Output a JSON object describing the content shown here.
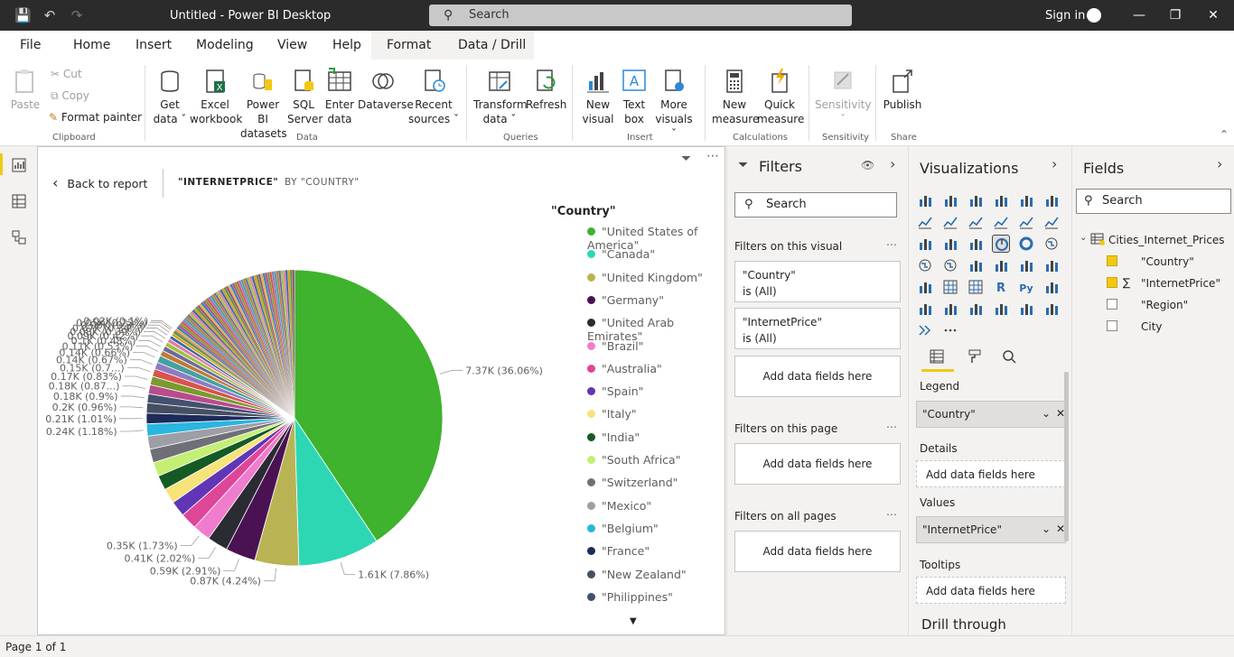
{
  "titlebar": {
    "title": "Untitled - Power BI Desktop",
    "search": "Search",
    "signin": "Sign in"
  },
  "menu": {
    "tabs": [
      "File",
      "Home",
      "Insert",
      "Modeling",
      "View",
      "Help",
      "Format",
      "Data / Drill"
    ]
  },
  "ribbon": {
    "clipboard": {
      "paste": "Paste",
      "cut": "Cut",
      "copy": "Copy",
      "format_painter": "Format painter",
      "group": "Clipboard"
    },
    "data": {
      "get1": "Get",
      "get2": "data",
      "excel1": "Excel",
      "excel2": "workbook",
      "pbi1": "Power BI",
      "pbi2": "datasets",
      "sql1": "SQL",
      "sql2": "Server",
      "enter1": "Enter",
      "enter2": "data",
      "dataverse": "Dataverse",
      "recent1": "Recent",
      "recent2": "sources",
      "group": "Data"
    },
    "queries": {
      "transform1": "Transform",
      "transform2": "data",
      "refresh": "Refresh",
      "group": "Queries"
    },
    "insert": {
      "newvis1": "New",
      "newvis2": "visual",
      "text1": "Text",
      "text2": "box",
      "more1": "More",
      "more2": "visuals",
      "group": "Insert"
    },
    "calc": {
      "newm1": "New",
      "newm2": "measure",
      "quick1": "Quick",
      "quick2": "measure",
      "group": "Calculations"
    },
    "sensitivity": {
      "label": "Sensitivity",
      "group": "Sensitivity"
    },
    "share": {
      "publish": "Publish",
      "group": "Share"
    }
  },
  "canvas": {
    "back": "Back to report",
    "crumb1": "\"INTERNETPRICE\"",
    "crumb2": "BY \"COUNTRY\"",
    "legend_title": "\"Country\""
  },
  "chart_data": {
    "type": "pie",
    "title": "",
    "legend_title": "\"Country\"",
    "legend": [
      "\"United States of America\"",
      "\"Canada\"",
      "\"United Kingdom\"",
      "\"Germany\"",
      "\"United Arab Emirates\"",
      "\"Brazil\"",
      "\"Australia\"",
      "\"Spain\"",
      "\"Italy\"",
      "\"India\"",
      "\"South Africa\"",
      "\"Switzerland\"",
      "\"Mexico\"",
      "\"Belgium\"",
      "\"France\"",
      "\"New Zealand\"",
      "\"Philippines\""
    ],
    "legend_colors": [
      "#3fb22e",
      "#2ed7b4",
      "#bab354",
      "#4a1153",
      "#2b2b33",
      "#f07ccd",
      "#de4697",
      "#6036b7",
      "#f6e37a",
      "#155a24",
      "#c4ef74",
      "#6f6f78",
      "#9e9ea6",
      "#29b6e0",
      "#1c2b5a",
      "#454f62",
      "#44516e"
    ],
    "slices": [
      {
        "label": "7.37K (36.06%)",
        "value": 7.37
      },
      {
        "label": "1.61K (7.86%)",
        "value": 1.61
      },
      {
        "label": "0.87K (4.24%)",
        "value": 0.87
      },
      {
        "label": "0.59K (2.91%)",
        "value": 0.59
      },
      {
        "label": "0.41K (2.02%)",
        "value": 0.41
      },
      {
        "label": "0.35K (1.73%)",
        "value": 0.35
      },
      {
        "label": "",
        "value": 0.33
      },
      {
        "label": "",
        "value": 0.31
      },
      {
        "label": "",
        "value": 0.3
      },
      {
        "label": "",
        "value": 0.29
      },
      {
        "label": "",
        "value": 0.28
      },
      {
        "label": "",
        "value": 0.27
      },
      {
        "label": "",
        "value": 0.26
      },
      {
        "label": "0.24K (1.18%)",
        "value": 0.24
      },
      {
        "label": "0.21K (1.01%)",
        "value": 0.21
      },
      {
        "label": "0.2K (0.96%)",
        "value": 0.2
      },
      {
        "label": "0.18K (0.9%)",
        "value": 0.18
      },
      {
        "label": "0.18K (0.87...)",
        "value": 0.18
      },
      {
        "label": "0.17K (0.83%)",
        "value": 0.17
      },
      {
        "label": "0.15K (0.7...)",
        "value": 0.15
      },
      {
        "label": "0.14K (0.67%)",
        "value": 0.14
      },
      {
        "label": "0.14K (0.66%)",
        "value": 0.14
      },
      {
        "label": "0.11K (0.53%)",
        "value": 0.11
      },
      {
        "label": "0.1K (0.48%)",
        "value": 0.1
      },
      {
        "label": "0.09K (0.42%)",
        "value": 0.09
      },
      {
        "label": "0.08K (0.39%)",
        "value": 0.08
      },
      {
        "label": "0.07K (0.34%)",
        "value": 0.07
      },
      {
        "label": "0.06K (0.3%)",
        "value": 0.06
      },
      {
        "label": "0.05K (0.22%)",
        "value": 0.05
      },
      {
        "label": "0.02K (0.1%)",
        "value": 0.02
      }
    ],
    "other_small_slices_count": 60,
    "other_small_slice_value": 0.045
  },
  "filters": {
    "title": "Filters",
    "search": "Search",
    "on_visual": "Filters on this visual",
    "f1a": "\"Country\"",
    "f1b": "is (All)",
    "f2a": "\"InternetPrice\"",
    "f2b": "is (All)",
    "add": "Add data fields here",
    "on_page": "Filters on this page",
    "on_all": "Filters on all pages"
  },
  "viz": {
    "title": "Visualizations",
    "legend": "Legend",
    "legend_field": "\"Country\"",
    "details": "Details",
    "add": "Add data fields here",
    "values": "Values",
    "values_field": "\"InternetPrice\"",
    "tooltips": "Tooltips",
    "drill": "Drill through"
  },
  "fields": {
    "title": "Fields",
    "search": "Search",
    "table": "Cities_Internet_Prices",
    "items": [
      "\"Country\"",
      "\"InternetPrice\"",
      "\"Region\"",
      "City"
    ],
    "sigma": "∑"
  },
  "status": {
    "page": "Page 1 of 1"
  }
}
